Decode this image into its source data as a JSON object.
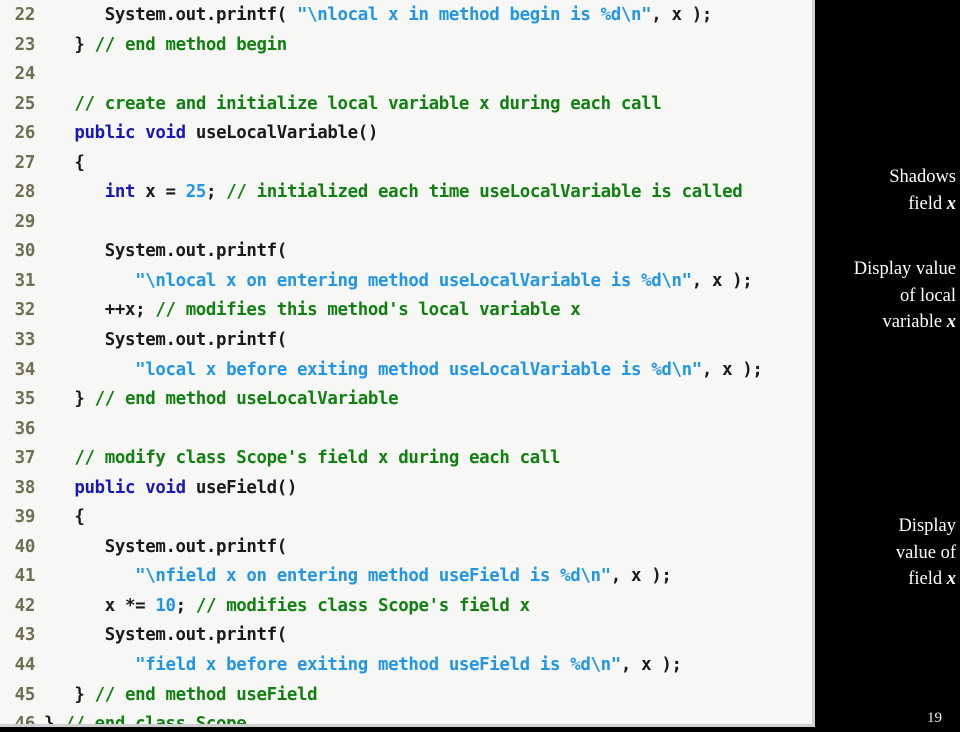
{
  "slide": {
    "page_number": "19",
    "background_color": "#000000",
    "code_panel_background": "#f7f7f5"
  },
  "syntax_colors": {
    "plain": "#1a1a1a",
    "keyword": "#1818b8",
    "string": "#2196e8",
    "number": "#2196e8",
    "comment": "#108010",
    "line_number": "#6f6f52"
  },
  "code": {
    "language": "Java",
    "first_line_number": 22,
    "last_line_number": 46,
    "lines": [
      {
        "n": "22",
        "tokens": [
          {
            "t": "plain",
            "s": "      System.out.printf( "
          },
          {
            "t": "str",
            "s": "\"\\nlocal x in method begin is %d\\n\""
          },
          {
            "t": "plain",
            "s": ", x );"
          }
        ]
      },
      {
        "n": "23",
        "tokens": [
          {
            "t": "plain",
            "s": "   } "
          },
          {
            "t": "com",
            "s": "// end method begin"
          }
        ]
      },
      {
        "n": "24",
        "tokens": []
      },
      {
        "n": "25",
        "tokens": [
          {
            "t": "plain",
            "s": "   "
          },
          {
            "t": "com",
            "s": "// create and initialize local variable x during each call"
          }
        ]
      },
      {
        "n": "26",
        "tokens": [
          {
            "t": "plain",
            "s": "   "
          },
          {
            "t": "kw",
            "s": "public void"
          },
          {
            "t": "plain",
            "s": " useLocalVariable()"
          }
        ]
      },
      {
        "n": "27",
        "tokens": [
          {
            "t": "plain",
            "s": "   {"
          }
        ]
      },
      {
        "n": "28",
        "tokens": [
          {
            "t": "plain",
            "s": "      "
          },
          {
            "t": "kw",
            "s": "int"
          },
          {
            "t": "plain",
            "s": " x = "
          },
          {
            "t": "num",
            "s": "25"
          },
          {
            "t": "plain",
            "s": "; "
          },
          {
            "t": "com",
            "s": "// initialized each time useLocalVariable is called"
          }
        ]
      },
      {
        "n": "29",
        "tokens": []
      },
      {
        "n": "30",
        "tokens": [
          {
            "t": "plain",
            "s": "      System.out.printf("
          }
        ]
      },
      {
        "n": "31",
        "tokens": [
          {
            "t": "plain",
            "s": "         "
          },
          {
            "t": "str",
            "s": "\"\\nlocal x on entering method useLocalVariable is %d\\n\""
          },
          {
            "t": "plain",
            "s": ", x );"
          }
        ]
      },
      {
        "n": "32",
        "tokens": [
          {
            "t": "plain",
            "s": "      ++x; "
          },
          {
            "t": "com",
            "s": "// modifies this method's local variable x"
          }
        ]
      },
      {
        "n": "33",
        "tokens": [
          {
            "t": "plain",
            "s": "      System.out.printf("
          }
        ]
      },
      {
        "n": "34",
        "tokens": [
          {
            "t": "plain",
            "s": "         "
          },
          {
            "t": "str",
            "s": "\"local x before exiting method useLocalVariable is %d\\n\""
          },
          {
            "t": "plain",
            "s": ", x );"
          }
        ]
      },
      {
        "n": "35",
        "tokens": [
          {
            "t": "plain",
            "s": "   } "
          },
          {
            "t": "com",
            "s": "// end method useLocalVariable"
          }
        ]
      },
      {
        "n": "36",
        "tokens": []
      },
      {
        "n": "37",
        "tokens": [
          {
            "t": "plain",
            "s": "   "
          },
          {
            "t": "com",
            "s": "// modify class Scope's field x during each call"
          }
        ]
      },
      {
        "n": "38",
        "tokens": [
          {
            "t": "plain",
            "s": "   "
          },
          {
            "t": "kw",
            "s": "public void"
          },
          {
            "t": "plain",
            "s": " useField()"
          }
        ]
      },
      {
        "n": "39",
        "tokens": [
          {
            "t": "plain",
            "s": "   {"
          }
        ]
      },
      {
        "n": "40",
        "tokens": [
          {
            "t": "plain",
            "s": "      System.out.printf("
          }
        ]
      },
      {
        "n": "41",
        "tokens": [
          {
            "t": "plain",
            "s": "         "
          },
          {
            "t": "str",
            "s": "\"\\nfield x on entering method useField is %d\\n\""
          },
          {
            "t": "plain",
            "s": ", x );"
          }
        ]
      },
      {
        "n": "42",
        "tokens": [
          {
            "t": "plain",
            "s": "      x *= "
          },
          {
            "t": "num",
            "s": "10"
          },
          {
            "t": "plain",
            "s": "; "
          },
          {
            "t": "com",
            "s": "// modifies class Scope's field x"
          }
        ]
      },
      {
        "n": "43",
        "tokens": [
          {
            "t": "plain",
            "s": "      System.out.printf("
          }
        ]
      },
      {
        "n": "44",
        "tokens": [
          {
            "t": "plain",
            "s": "         "
          },
          {
            "t": "str",
            "s": "\"field x before exiting method useField is %d\\n\""
          },
          {
            "t": "plain",
            "s": ", x );"
          }
        ]
      },
      {
        "n": "45",
        "tokens": [
          {
            "t": "plain",
            "s": "   } "
          },
          {
            "t": "com",
            "s": "// end method useField"
          }
        ]
      },
      {
        "n": "46",
        "tokens": [
          {
            "t": "plain",
            "s": "} "
          },
          {
            "t": "com",
            "s": "// end class Scope"
          }
        ]
      }
    ]
  },
  "annotations": [
    {
      "id": "shadows",
      "lines": [
        [
          {
            "kind": "text",
            "s": "Shadows"
          }
        ],
        [
          {
            "kind": "text",
            "s": "field "
          },
          {
            "kind": "var",
            "s": "x"
          }
        ]
      ]
    },
    {
      "id": "local",
      "lines": [
        [
          {
            "kind": "text",
            "s": "Display value"
          }
        ],
        [
          {
            "kind": "text",
            "s": "of local"
          }
        ],
        [
          {
            "kind": "text",
            "s": "variable "
          },
          {
            "kind": "var",
            "s": "x"
          }
        ]
      ]
    },
    {
      "id": "field",
      "lines": [
        [
          {
            "kind": "text",
            "s": "Display"
          }
        ],
        [
          {
            "kind": "text",
            "s": "value of"
          }
        ],
        [
          {
            "kind": "text",
            "s": "field "
          },
          {
            "kind": "var",
            "s": "x"
          }
        ]
      ]
    }
  ]
}
